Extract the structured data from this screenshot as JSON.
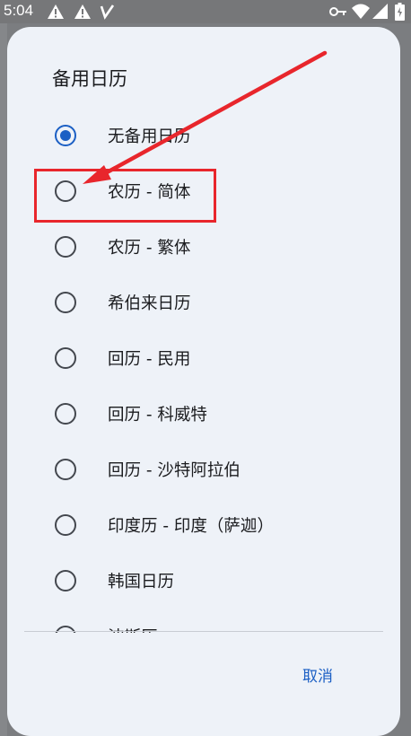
{
  "status_bar": {
    "time": "5:04",
    "icons": [
      "warning-icon",
      "warning-icon",
      "network-icon",
      "vpn-key-icon",
      "wifi-icon",
      "signal-icon",
      "battery-icon"
    ]
  },
  "dialog": {
    "title": "备用日历",
    "options": [
      {
        "label": "无备用日历",
        "selected": true
      },
      {
        "label": "农历 - 简体",
        "selected": false,
        "highlighted": true
      },
      {
        "label": "农历 - 繁体",
        "selected": false
      },
      {
        "label": "希伯来日历",
        "selected": false
      },
      {
        "label": "回历 - 民用",
        "selected": false
      },
      {
        "label": "回历 - 科威特",
        "selected": false
      },
      {
        "label": "回历 - 沙特阿拉伯",
        "selected": false
      },
      {
        "label": "印度历 - 印度（萨迦）",
        "selected": false
      },
      {
        "label": "韩国日历",
        "selected": false
      },
      {
        "label": "波斯历",
        "selected": false
      }
    ],
    "cancel_label": "取消"
  },
  "colors": {
    "accent": "#1b5fc4",
    "annotation": "#e8262c",
    "dialog_bg": "#eef2f8",
    "scrim": "#7b7d80"
  }
}
